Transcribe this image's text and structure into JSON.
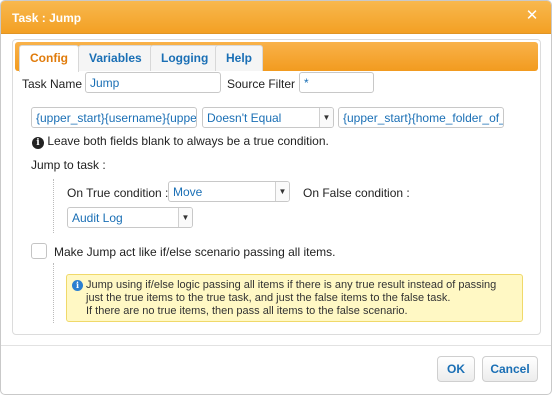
{
  "dialog": {
    "title": "Task : Jump",
    "close_symbol": "✕"
  },
  "tabs": [
    {
      "label": "Config",
      "active": true
    },
    {
      "label": "Variables",
      "active": false
    },
    {
      "label": "Logging",
      "active": false
    },
    {
      "label": "Help",
      "active": false
    }
  ],
  "config": {
    "task_name_label": "Task Name :",
    "task_name_value": "Jump",
    "source_filter_label": "Source Filter :",
    "source_filter_value": "*",
    "condition_left_value": "{upper_start}{username}{upper_start}{home_folder_of_}",
    "condition_operator": "Doesn't Equal",
    "condition_right_value": "{upper_start}{home_folder_of_",
    "blank_hint": "Leave both fields blank to always be a true condition.",
    "jump_to_task_label": "Jump to task :",
    "on_true_label": "On True condition :",
    "on_true_value": "Move",
    "on_false_label": "On False condition :",
    "on_false_value": "Audit Log",
    "ifelse_checkbox_label": "Make Jump act like if/else scenario passing all items.",
    "ifelse_checked": false,
    "note_lines": [
      "Jump using if/else logic passing all items if there is any true result instead of passing",
      "just the true items to the true task, and just the false items to the false task.",
      "If there are no true items, then pass all items to the false scenario."
    ]
  },
  "footer": {
    "ok_label": "OK",
    "cancel_label": "Cancel"
  },
  "icons": {
    "info": "info-icon",
    "close": "close-icon",
    "dropdown": "chevron-down-icon"
  },
  "colors": {
    "titlebar": "#f3a024",
    "tab_active_text": "#e07b0b",
    "link_text": "#1a6fb5",
    "note_background": "#fff8c4"
  }
}
